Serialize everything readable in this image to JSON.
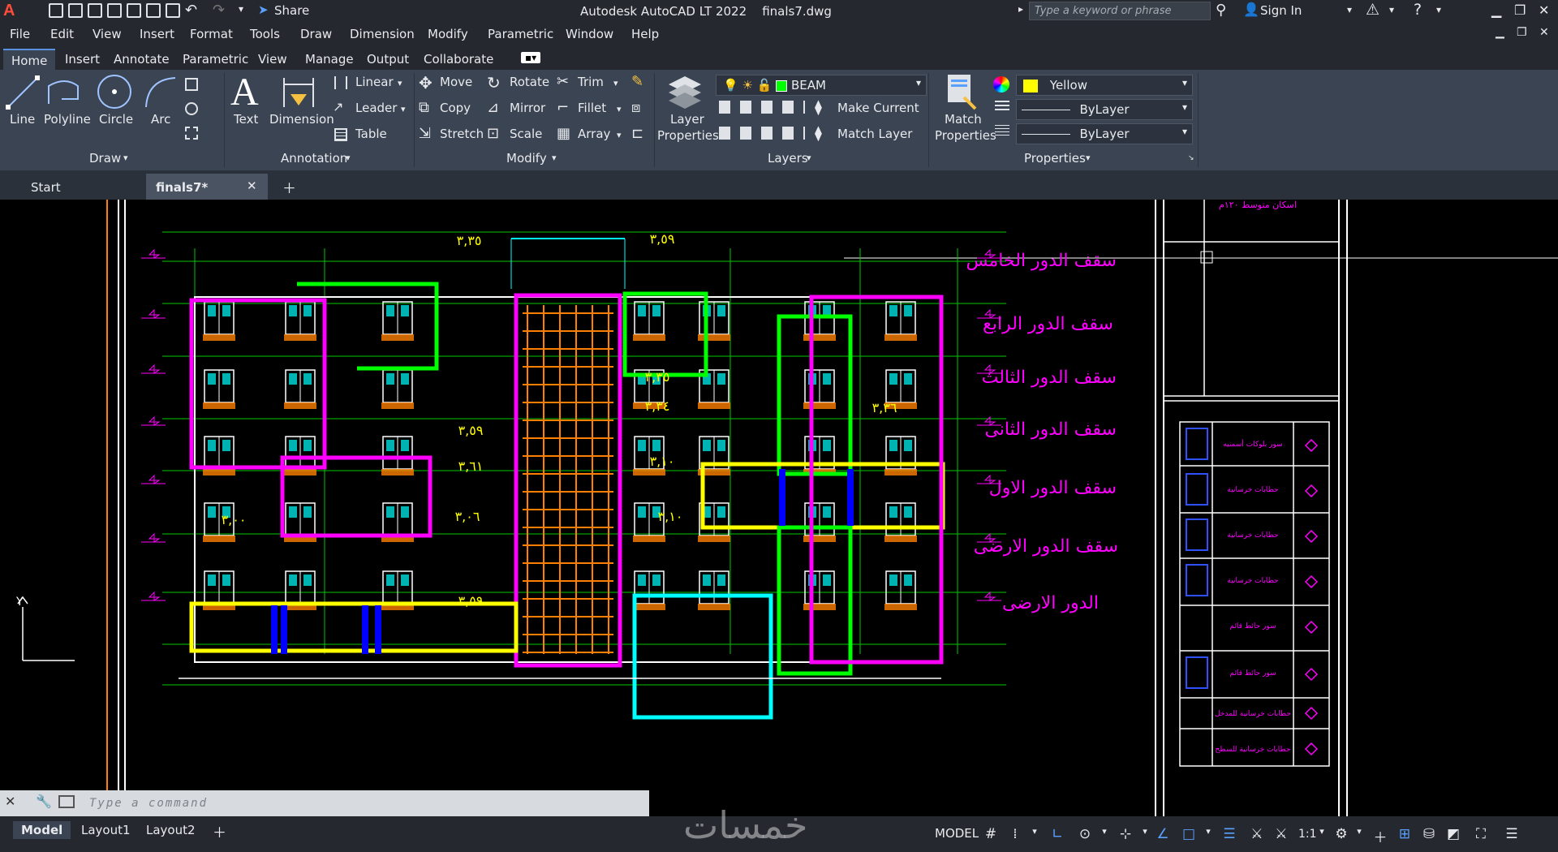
{
  "app": {
    "title": "Autodesk AutoCAD LT 2022    finals7.dwg",
    "logo": "A LT",
    "share_label": "Share",
    "search_placeholder": "Type a keyword or phrase",
    "signin_label": "Sign In"
  },
  "menu": [
    "File",
    "Edit",
    "View",
    "Insert",
    "Format",
    "Tools",
    "Draw",
    "Dimension",
    "Modify",
    "Parametric",
    "Window",
    "Help"
  ],
  "ribbon_tabs": [
    "Home",
    "Insert",
    "Annotate",
    "Parametric",
    "View",
    "Manage",
    "Output",
    "Collaborate"
  ],
  "ribbon": {
    "draw": {
      "line": "Line",
      "polyline": "Polyline",
      "circle": "Circle",
      "arc": "Arc",
      "title": "Draw"
    },
    "annotation": {
      "text": "Text",
      "dimension": "Dimension",
      "linear": "Linear",
      "leader": "Leader",
      "table": "Table",
      "title": "Annotation"
    },
    "modify": {
      "move": "Move",
      "rotate": "Rotate",
      "trim": "Trim",
      "copy": "Copy",
      "mirror": "Mirror",
      "fillet": "Fillet",
      "stretch": "Stretch",
      "scale": "Scale",
      "array": "Array",
      "title": "Modify"
    },
    "layers": {
      "layer_properties_1": "Layer",
      "layer_properties_2": "Properties",
      "current_layer": "BEAM",
      "make_current": "Make Current",
      "match_layer": "Match Layer",
      "title": "Layers"
    },
    "properties": {
      "match_1": "Match",
      "match_2": "Properties",
      "color": "Yellow",
      "linetype": "ByLayer",
      "lineweight": "ByLayer",
      "title": "Properties"
    }
  },
  "doc_tabs": {
    "start": "Start",
    "active": "finals7*"
  },
  "drawing": {
    "floor_labels": [
      "سقف الدور الخامس",
      "سقف الدور الرابع",
      "سقف الدور الثالث",
      "سقف الدور الثانى",
      "سقف الدور الاول",
      "سقف الدور الارضى",
      "الدور الارضى"
    ],
    "dims": [
      "٣,٣٥",
      "٣,٥٩",
      "٣,٣٥",
      "٣,٣٤",
      "٣,٣٦",
      "٣,٥٩",
      "٣,٦١",
      "٣,١٠",
      "٣,٠٦",
      "٣,٠٠",
      "٣,١٠",
      "٣,٥٩"
    ],
    "legend_header": "اسكان متوسط ١٢٠م",
    "legend_items": [
      "سور بلوكات أسمنيه",
      "حطابات خرسانية",
      "حطابات خرسانية",
      "حطابات خرسانية",
      "سور حائط قائم",
      "سور حائط قائم",
      "حطابات خرسانية للمدخل",
      "حطابات خرسانية للسطح"
    ]
  },
  "command": {
    "placeholder": "Type a command"
  },
  "layout_tabs": [
    "Model",
    "Layout1",
    "Layout2"
  ],
  "status": {
    "model": "MODEL",
    "scale": "1:1"
  },
  "watermark": "خمسات",
  "colors": {
    "magenta": "#ff00ff",
    "green": "#00ff00",
    "yellow": "#ffff00",
    "cyan": "#00ffff",
    "orange": "#ff8000",
    "blue": "#0000ff",
    "white": "#ffffff"
  }
}
